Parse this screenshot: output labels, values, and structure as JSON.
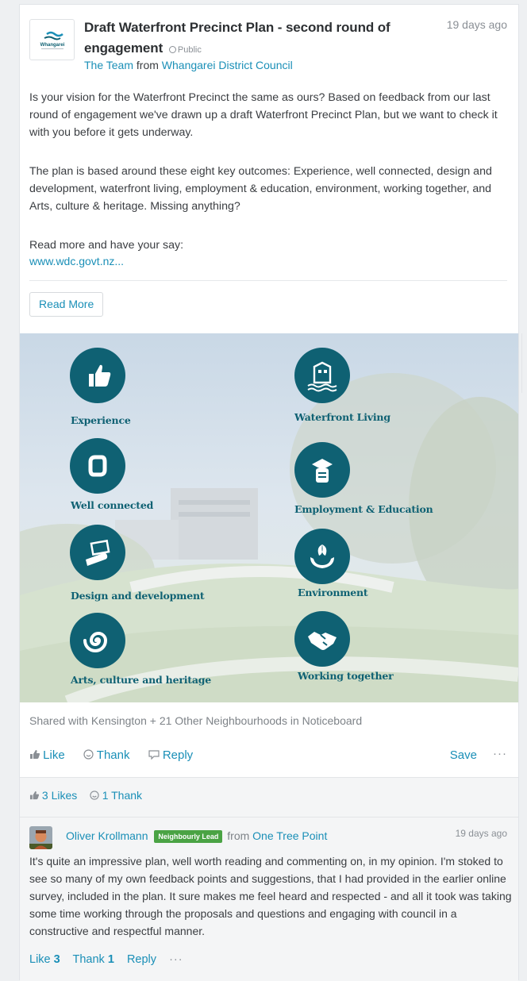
{
  "post": {
    "logo_text": "Whangarei",
    "title": "Draft Waterfront Precinct Plan - second round of engagement",
    "visibility": "Public",
    "time": "19 days ago",
    "author": "The Team",
    "from_word": "from",
    "organisation": "Whangarei District Council",
    "paragraph1": "Is your vision for the Waterfront Precinct the same as ours? Based on feedback from our last round of engagement we've drawn up a draft Waterfront Precinct Plan, but we want to check it with you before it gets underway.",
    "paragraph2": "The plan is based around these eight key outcomes: Experience, well connected, design and development, waterfront living, employment & education, environment, working together, and Arts, culture & heritage. Missing anything?",
    "paragraph3": "Read more and have your say:",
    "url": "www.wdc.govt.nz...",
    "read_more": "Read More",
    "image_labels": {
      "experience": "Experience",
      "waterfront_living": "Waterfront Living",
      "well_connected": "Well connected",
      "employment": "Employment & Education",
      "design": "Design and development",
      "environment": "Environment",
      "arts": "Arts, culture and heritage",
      "working_together": "Working together"
    },
    "shared_with": "Shared with Kensington + 21 Other Neighbourhoods in Noticeboard",
    "actions": {
      "like": "Like",
      "thank": "Thank",
      "reply": "Reply",
      "save": "Save",
      "more": "···"
    },
    "reactions": {
      "likes": "3 Likes",
      "thanks": "1 Thank"
    }
  },
  "comment": {
    "author": "Oliver Krollmann",
    "badge": "Neighbourly Lead",
    "from_word": "from",
    "location": "One Tree Point",
    "time": "19 days ago",
    "text": "It's quite an impressive plan, well worth reading and commenting on, in my opinion. I'm stoked to see so many of my own feedback points and suggestions, that I had provided in the earlier online survey, included in the plan. It sure makes me feel heard and respected - and all it took was taking some time working through the proposals and questions and engaging with council in a constructive and respectful manner.",
    "like_label": "Like",
    "like_count": "3",
    "thank_label": "Thank",
    "thank_count": "1",
    "reply_label": "Reply",
    "more": "···"
  },
  "colors": {
    "link": "#1a8fb7",
    "teal": "#0f6173",
    "badge": "#4aa344"
  }
}
